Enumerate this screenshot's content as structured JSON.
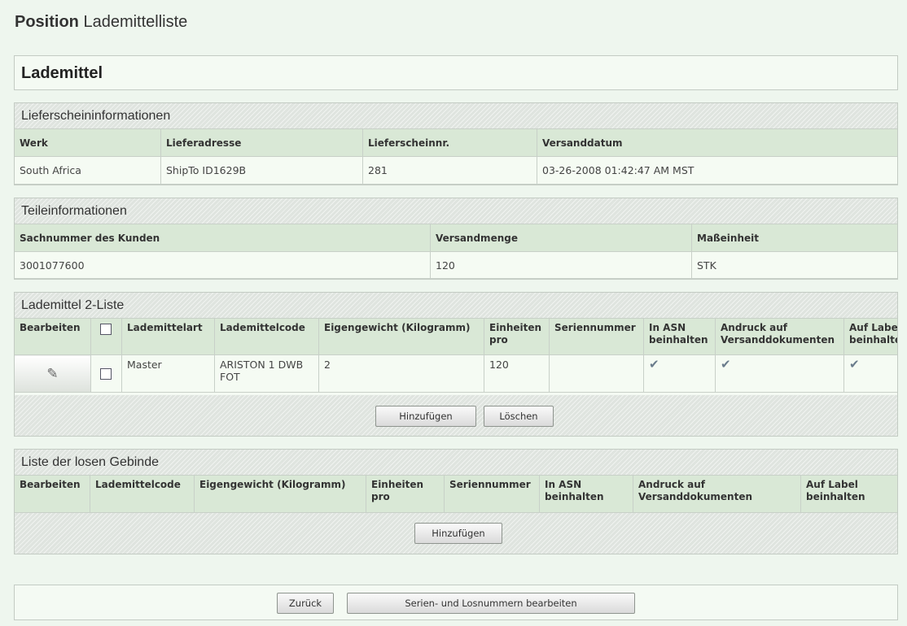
{
  "page": {
    "title_bold": "Position",
    "title_rest": "Lademittelliste"
  },
  "header": {
    "title": "Lademittel"
  },
  "delivery": {
    "heading": "Lieferscheininformationen",
    "columns": [
      "Werk",
      "Lieferadresse",
      "Lieferscheinnr.",
      "Versanddatum"
    ],
    "row": [
      "South Africa",
      "ShipTo ID1629B",
      "281",
      "03-26-2008 01:42:47 AM MST"
    ]
  },
  "part": {
    "heading": "Teileinformationen",
    "columns": [
      "Sachnummer des Kunden",
      "Versandmenge",
      "Maßeinheit"
    ],
    "row": [
      "3001077600",
      "120",
      "STK"
    ]
  },
  "lm2": {
    "heading": "Lademittel 2-Liste",
    "columns": [
      "Bearbeiten",
      "",
      "Lademittelart",
      "Lademittelcode",
      "Eigengewicht (Kilogramm)",
      "Einheiten pro",
      "Seriennummer",
      "In ASN beinhalten",
      "Andruck auf Versanddokumenten",
      "Auf Label beinhalten"
    ],
    "rows": [
      {
        "type": "Master",
        "code": "ARISTON 1 DWB FOT",
        "weight": "2",
        "units": "120",
        "serial": "",
        "in_asn": true,
        "print_docs": true,
        "on_label": true
      }
    ],
    "add_label": "Hinzufügen",
    "delete_label": "Löschen"
  },
  "loose": {
    "heading": "Liste der losen Gebinde",
    "columns": [
      "Bearbeiten",
      "Lademittelcode",
      "Eigengewicht (Kilogramm)",
      "Einheiten pro",
      "Seriennummer",
      "In ASN beinhalten",
      "Andruck auf Versanddokumenten",
      "Auf Label beinhalten"
    ],
    "add_label": "Hinzufügen"
  },
  "footer": {
    "back_label": "Zurück",
    "serial_label": "Serien- und Losnummern bearbeiten"
  },
  "icons": {
    "edit": "pencil-icon",
    "check": "checkmark-icon"
  }
}
